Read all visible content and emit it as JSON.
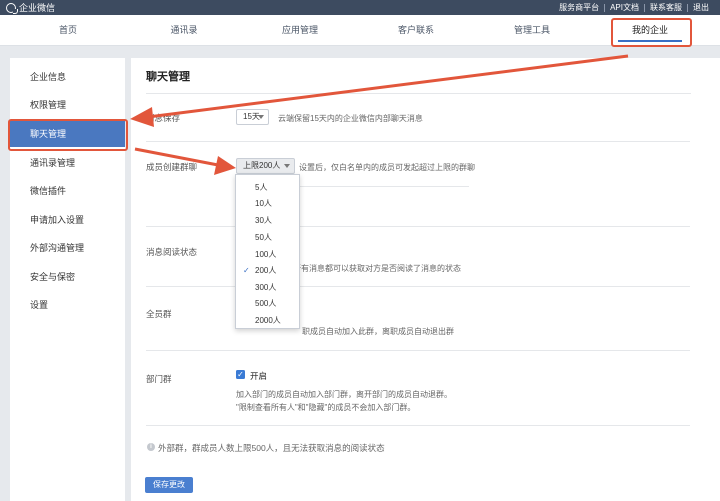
{
  "app": {
    "name": "企业微信"
  },
  "top_links": [
    "服务商平台",
    "API文档",
    "联系客服",
    "退出"
  ],
  "nav": {
    "items": [
      "首页",
      "通讯录",
      "应用管理",
      "客户联系",
      "管理工具",
      "我的企业"
    ],
    "active_index": 5
  },
  "sidebar": {
    "items": [
      "企业信息",
      "权限管理",
      "聊天管理",
      "通讯录管理",
      "微信插件",
      "申请加入设置",
      "外部沟通管理",
      "安全与保密",
      "设置"
    ],
    "active_index": 2
  },
  "page": {
    "title": "聊天管理",
    "msg_save": {
      "label": "消息保存",
      "value": "15天",
      "hint": "云端保留15天内的企业微信内部聊天消息"
    },
    "group_limit": {
      "label": "成员创建群聊",
      "value": "上限200人",
      "hint": "设置后，仅白名单内的成员可发起超过上限的群聊",
      "options": [
        "5人",
        "10人",
        "30人",
        "50人",
        "100人",
        "200人",
        "300人",
        "500人",
        "2000人"
      ],
      "selected_index": 5
    },
    "read_status": {
      "label": "消息阅读状态",
      "hint": "的所有消息都可以获取对方是否阅读了消息的状态"
    },
    "all_group": {
      "label": "全员群",
      "hint": "职成员自动加入此群，离职成员自动退出群"
    },
    "dept_group": {
      "label": "部门群",
      "checkbox_label": "开启",
      "checked": true,
      "desc_line1": "加入部门的成员自动加入部门群，离开部门的成员自动退群。",
      "desc_line2": "\"限制查看所有人\"和\"隐藏\"的成员不会加入部门群。"
    },
    "note": "外部群，群成员人数上限500人，且无法获取消息的阅读状态",
    "save_label": "保存更改"
  },
  "colors": {
    "accent": "#4a78c0",
    "topbar": "#3d4b60",
    "highlight": "#e2563b"
  }
}
